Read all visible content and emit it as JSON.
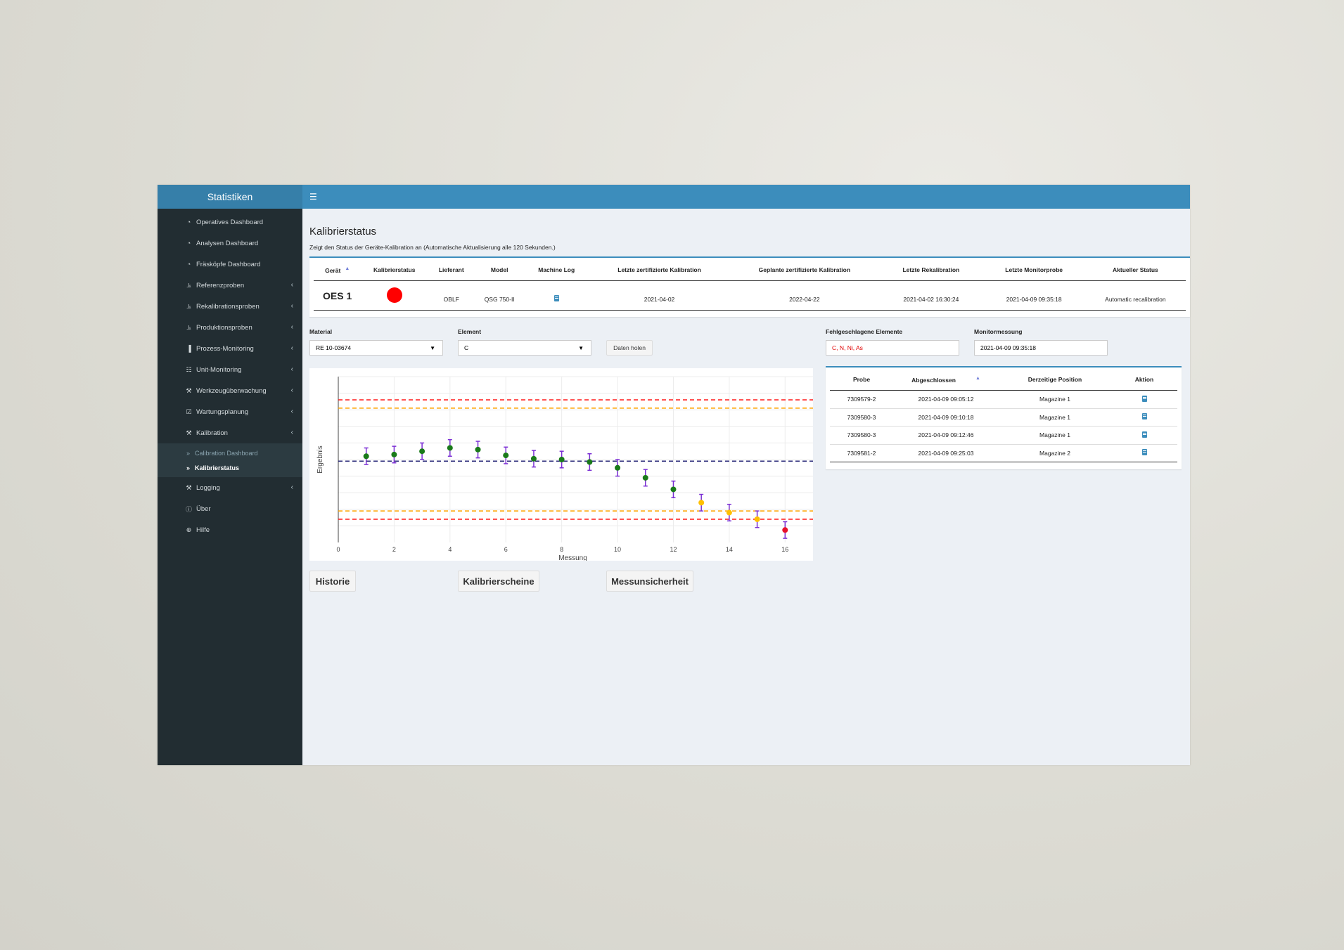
{
  "sidebar": {
    "brand": "Statistiken",
    "items": [
      {
        "label": "Operatives Dashboard",
        "icon": "dashboard-icon",
        "chevron": false
      },
      {
        "label": "Analysen Dashboard",
        "icon": "dashboard-icon",
        "chevron": false
      },
      {
        "label": "Fräsköpfe Dashboard",
        "icon": "dashboard-icon",
        "chevron": false
      },
      {
        "label": "Referenzproben",
        "icon": "line-chart-icon",
        "chevron": true
      },
      {
        "label": "Rekalibrationsproben",
        "icon": "line-chart-icon",
        "chevron": true
      },
      {
        "label": "Produktionsproben",
        "icon": "line-chart-icon",
        "chevron": true
      },
      {
        "label": "Prozess-Monitoring",
        "icon": "bar-chart-icon",
        "chevron": true
      },
      {
        "label": "Unit-Monitoring",
        "icon": "sitemap-icon",
        "chevron": true
      },
      {
        "label": "Werkzeugüberwachung",
        "icon": "wrench-icon",
        "chevron": true
      },
      {
        "label": "Wartungsplanung",
        "icon": "calendar-check-icon",
        "chevron": true
      },
      {
        "label": "Kalibration",
        "icon": "wrench-icon",
        "chevron": true
      }
    ],
    "subitems": [
      {
        "label": "Calibration Dashboard",
        "icon": "double-angle-right-icon",
        "active": false
      },
      {
        "label": "Kalibrierstatus",
        "icon": "double-angle-right-icon",
        "active": true
      }
    ],
    "items_after": [
      {
        "label": "Logging",
        "icon": "wrench-icon",
        "chevron": true
      },
      {
        "label": "Über",
        "icon": "info-icon",
        "chevron": false
      },
      {
        "label": "Hilfe",
        "icon": "globe-icon",
        "chevron": false
      }
    ]
  },
  "header": {
    "menu_icon": "hamburger-icon"
  },
  "page": {
    "title": "Kalibrierstatus",
    "subtitle": "Zeigt den Status der Geräte-Kalibration an (Automatische Aktualisierung alle 120 Sekunden.)"
  },
  "device_table": {
    "columns": [
      "Gerät",
      "Kalibrierstatus",
      "Lieferant",
      "Model",
      "Machine Log",
      "Letzte zertifizierte Kalibration",
      "Geplante zertifizierte Kalibration",
      "Letzte Rekalibration",
      "Letzte Monitorprobe",
      "Aktueller Status"
    ],
    "row": {
      "geraet": "OES 1",
      "status_color": "#ff0000",
      "lieferant": "OBLF",
      "model": "QSG 750-II",
      "machine_log_icon": "book-icon",
      "letzte_zert": "2021-04-02",
      "geplante_zert": "2022-04-22",
      "letzte_rekal": "2021-04-02 16:30:24",
      "letzte_monitor": "2021-04-09 09:35:18",
      "aktueller_status": "Automatic recalibration"
    }
  },
  "filters": {
    "material_label": "Material",
    "material_value": "RE 10-03674",
    "element_label": "Element",
    "element_value": "C",
    "fetch_button": "Daten holen",
    "failed_label": "Fehlgeschlagene Elemente",
    "failed_value": "C, N, Ni, As",
    "monitor_label": "Monitormessung",
    "monitor_value": "2021-04-09 09:35:18"
  },
  "probe_table": {
    "columns": [
      "Probe",
      "Abgeschlossen",
      "Derzeitige Position",
      "Aktion"
    ],
    "rows": [
      {
        "probe": "7309579-2",
        "abgeschlossen": "2021-04-09 09:05:12",
        "position": "Magazine 1"
      },
      {
        "probe": "7309580-3",
        "abgeschlossen": "2021-04-09 09:10:18",
        "position": "Magazine 1"
      },
      {
        "probe": "7309580-3",
        "abgeschlossen": "2021-04-09 09:12:46",
        "position": "Magazine 1"
      },
      {
        "probe": "7309581-2",
        "abgeschlossen": "2021-04-09 09:25:03",
        "position": "Magazine 2"
      }
    ]
  },
  "buttons": {
    "historie": "Historie",
    "kalibrierscheine": "Kalibrierscheine",
    "messunsicherheit": "Messunsicherheit"
  },
  "chart_data": {
    "type": "scatter",
    "xlabel": "Messung",
    "ylabel": "Ergebnis",
    "xlim": [
      0,
      17
    ],
    "ylim": [
      0,
      10
    ],
    "xticks": [
      0,
      2,
      4,
      6,
      8,
      10,
      12,
      14,
      16
    ],
    "grid": true,
    "reference_lines": [
      {
        "y": 8.6,
        "color": "#ff2020"
      },
      {
        "y": 8.1,
        "color": "#ffa500"
      },
      {
        "y": 4.9,
        "color": "#2b2b7a"
      },
      {
        "y": 1.9,
        "color": "#ffa500"
      },
      {
        "y": 1.4,
        "color": "#ff2020"
      }
    ],
    "points": [
      {
        "x": 1,
        "y": 5.2,
        "err": 0.5,
        "color": "#1a7a1a"
      },
      {
        "x": 2,
        "y": 5.3,
        "err": 0.5,
        "color": "#1a7a1a"
      },
      {
        "x": 3,
        "y": 5.5,
        "err": 0.5,
        "color": "#1a7a1a"
      },
      {
        "x": 4,
        "y": 5.7,
        "err": 0.5,
        "color": "#1a7a1a"
      },
      {
        "x": 5,
        "y": 5.6,
        "err": 0.5,
        "color": "#1a7a1a"
      },
      {
        "x": 6,
        "y": 5.25,
        "err": 0.5,
        "color": "#1a7a1a"
      },
      {
        "x": 7,
        "y": 5.05,
        "err": 0.5,
        "color": "#1a7a1a"
      },
      {
        "x": 8,
        "y": 5.0,
        "err": 0.5,
        "color": "#1a7a1a"
      },
      {
        "x": 9,
        "y": 4.85,
        "err": 0.5,
        "color": "#1a7a1a"
      },
      {
        "x": 10,
        "y": 4.5,
        "err": 0.5,
        "color": "#1a7a1a"
      },
      {
        "x": 11,
        "y": 3.9,
        "err": 0.5,
        "color": "#1a7a1a"
      },
      {
        "x": 12,
        "y": 3.2,
        "err": 0.5,
        "color": "#1a7a1a"
      },
      {
        "x": 13,
        "y": 2.4,
        "err": 0.5,
        "color": "#ffc000"
      },
      {
        "x": 14,
        "y": 1.8,
        "err": 0.5,
        "color": "#ffc000"
      },
      {
        "x": 15,
        "y": 1.4,
        "err": 0.5,
        "color": "#ffc000"
      },
      {
        "x": 16,
        "y": 0.75,
        "err": 0.5,
        "color": "#e8102a"
      }
    ],
    "errorbar_color": "#7b2fd4"
  }
}
